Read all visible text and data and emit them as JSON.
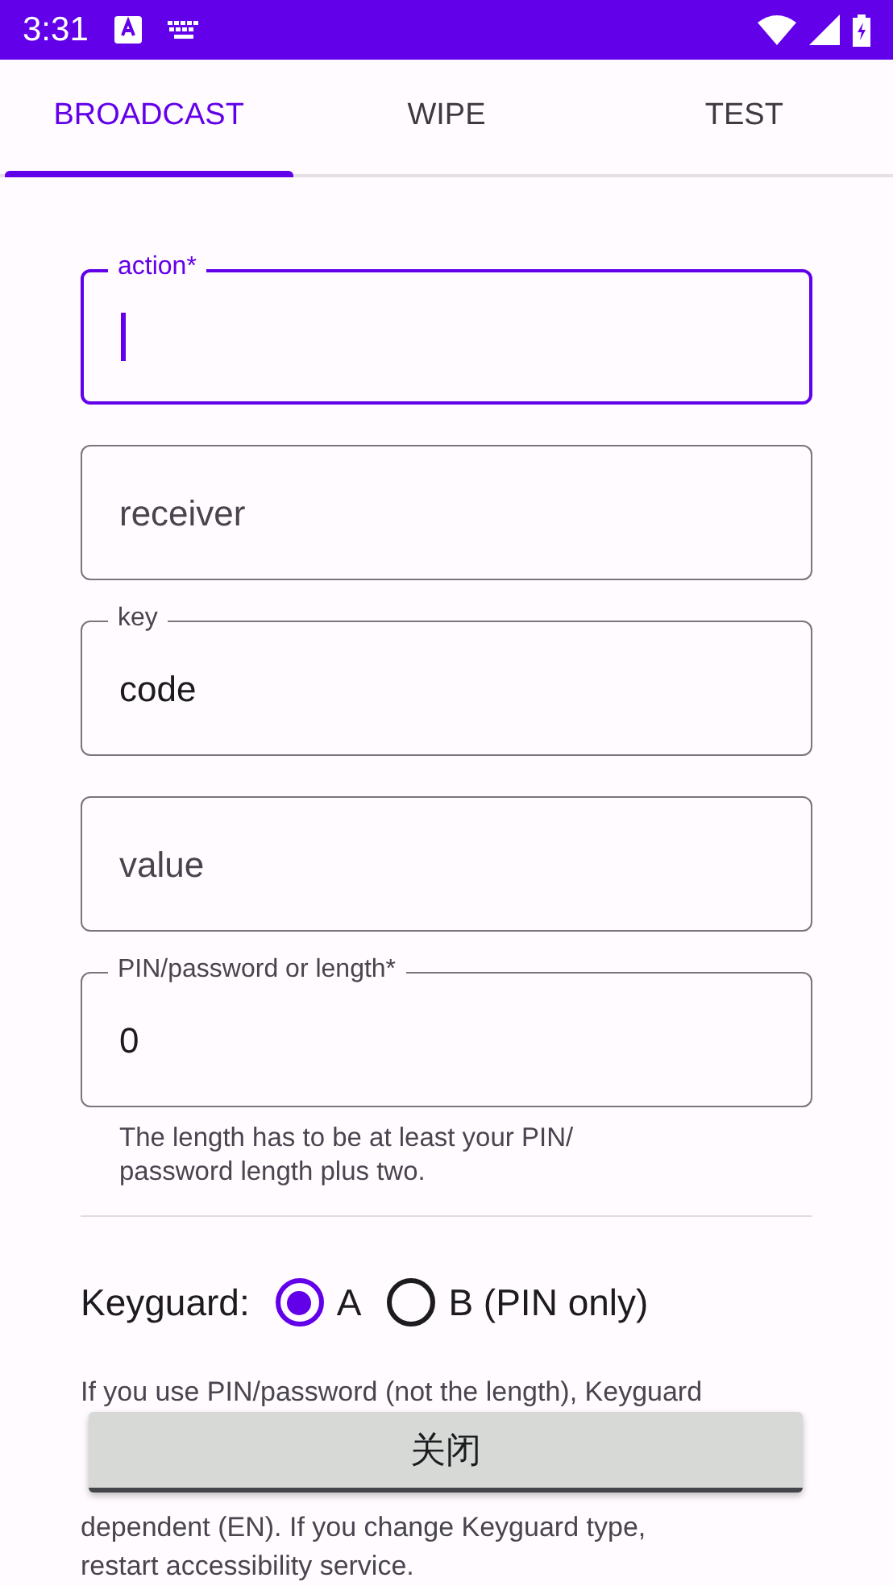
{
  "status_bar": {
    "time": "3:31"
  },
  "tabs": [
    {
      "label": "BROADCAST",
      "selected": true
    },
    {
      "label": "WIPE",
      "selected": false
    },
    {
      "label": "TEST",
      "selected": false
    }
  ],
  "fields": [
    {
      "label": "action*",
      "focused": true
    },
    {
      "label": "receiver",
      "focused": false
    },
    {
      "label": "key",
      "value": "code",
      "focused": false
    },
    {
      "label": "value",
      "focused": false
    },
    {
      "label": "PIN/password or length*",
      "value": "0",
      "focused": false,
      "helper": "The length has to be at least your PIN/ password length plus two."
    }
  ],
  "keyguard": {
    "label": "Keyguard:",
    "options": [
      {
        "label": "A",
        "selected": true
      },
      {
        "label": "B (PIN only)",
        "selected": false
      }
    ]
  },
  "note": {
    "top_lines": [
      "If you use PIN/password (not the length), Keyguard"
    ],
    "bottom_lines": [
      "dependent (EN). If you change Keyguard type,",
      "restart accessibility service."
    ]
  },
  "toast": {
    "text": "关闭"
  }
}
